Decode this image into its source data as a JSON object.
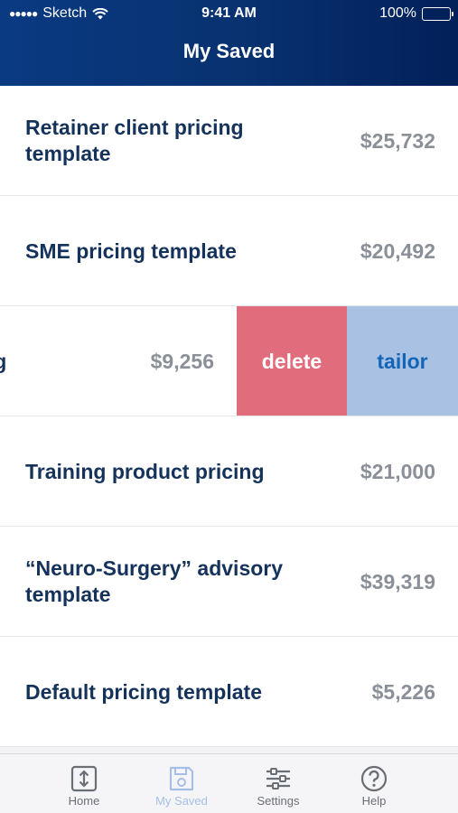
{
  "status_bar": {
    "signal": "●●●●●",
    "carrier": "Sketch",
    "time": "9:41 AM",
    "battery": "100%"
  },
  "header": {
    "title": "My Saved"
  },
  "items": [
    {
      "name": "Retainer client pricing template",
      "price": "$25,732"
    },
    {
      "name": "SME pricing template",
      "price": "$20,492"
    },
    {
      "name": "cing",
      "price": "$9,256",
      "actions": {
        "delete": "delete",
        "tailor": "tailor"
      }
    },
    {
      "name": "Training product pricing",
      "price": "$21,000"
    },
    {
      "name": "“Neuro-Surgery” advisory template",
      "price": "$39,319"
    },
    {
      "name": "Default pricing template",
      "price": "$5,226"
    }
  ],
  "tabs": [
    {
      "label": "Home",
      "icon": "home-sort-icon"
    },
    {
      "label": "My Saved",
      "icon": "save-disk-icon",
      "active": true
    },
    {
      "label": "Settings",
      "icon": "sliders-icon"
    },
    {
      "label": "Help",
      "icon": "help-icon"
    }
  ],
  "colors": {
    "header": "#0a3a82",
    "delete": "#e16d7c",
    "tailor": "#a9c1e3",
    "active_tab": "#a5bfe6"
  }
}
